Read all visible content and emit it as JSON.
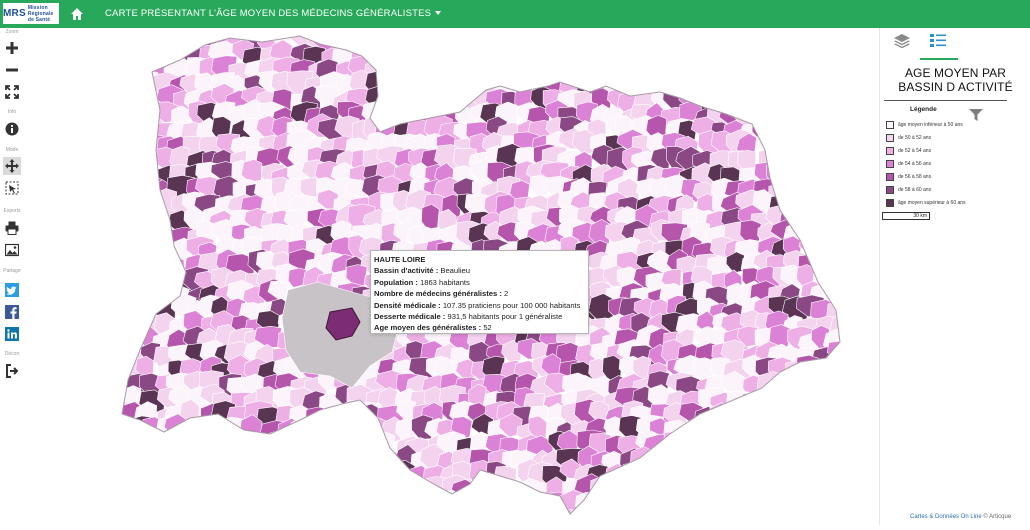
{
  "header": {
    "logo_text": "MRS",
    "logo_subtext": "Mission Régionale de Santé",
    "title": "CARTE PRÉSENTANT L'ÂGE MOYEN DES MÉDECINS GÉNÉRALISTES",
    "bg_color": "#27a85a"
  },
  "toolbar": {
    "sections": [
      {
        "label": "Zoom",
        "buttons": [
          "zoom-in-icon",
          "zoom-out-icon",
          "full-extent-icon"
        ]
      },
      {
        "label": "Info",
        "buttons": [
          "info-icon"
        ]
      },
      {
        "label": "Mode",
        "buttons": [
          "pan-icon",
          "select-icon"
        ]
      },
      {
        "label": "Exports",
        "buttons": [
          "print-icon",
          "image-export-icon"
        ]
      },
      {
        "label": "Partage",
        "buttons": [
          "twitter-icon",
          "facebook-icon",
          "linkedin-icon"
        ]
      },
      {
        "label": "Décon",
        "buttons": [
          "logout-icon"
        ]
      }
    ]
  },
  "tooltip": {
    "region": "HAUTE LOIRE",
    "rows": [
      {
        "label": "Bassin d'activité :",
        "value": "Beaulieu"
      },
      {
        "label": "Population :",
        "value": "1863 habitants"
      },
      {
        "label": "Nombre de médecins généralistes :",
        "value": "2"
      },
      {
        "label": "Densité médicale :",
        "value": "107.35 praticiens pour 100 000 habitants"
      },
      {
        "label": "Desserte médicale :",
        "value": "931,5 habitants pour 1 généraliste"
      },
      {
        "label": "Age moyen des généralistes :",
        "value": "52"
      }
    ]
  },
  "legend": {
    "title_line1": "AGE MOYEN PAR",
    "title_line2": "BASSIN D ACTIVITÉ",
    "subtitle": "Légende",
    "classes": [
      {
        "label": "âge moyen inférieur à 50 ans",
        "color": "#fbf4fa"
      },
      {
        "label": "de 50 à 52 ans",
        "color": "#f4d3ee"
      },
      {
        "label": "de 52 à 54 ans",
        "color": "#eeaee6"
      },
      {
        "label": "de 54 à 56 ans",
        "color": "#dc82d6"
      },
      {
        "label": "de 56 à 58 ans",
        "color": "#b655ac"
      },
      {
        "label": "de 58 à 60 ans",
        "color": "#8a4885"
      },
      {
        "label": "âge moyen supérieur à 60 ans",
        "color": "#5a3553"
      }
    ],
    "scale_label": "30 km"
  },
  "credits": {
    "link": "Cartes & Données On Line",
    "suffix": " © Articque"
  },
  "map": {
    "no_data_color": "#c8c3c6",
    "highlight_color": "#7b2c73"
  }
}
